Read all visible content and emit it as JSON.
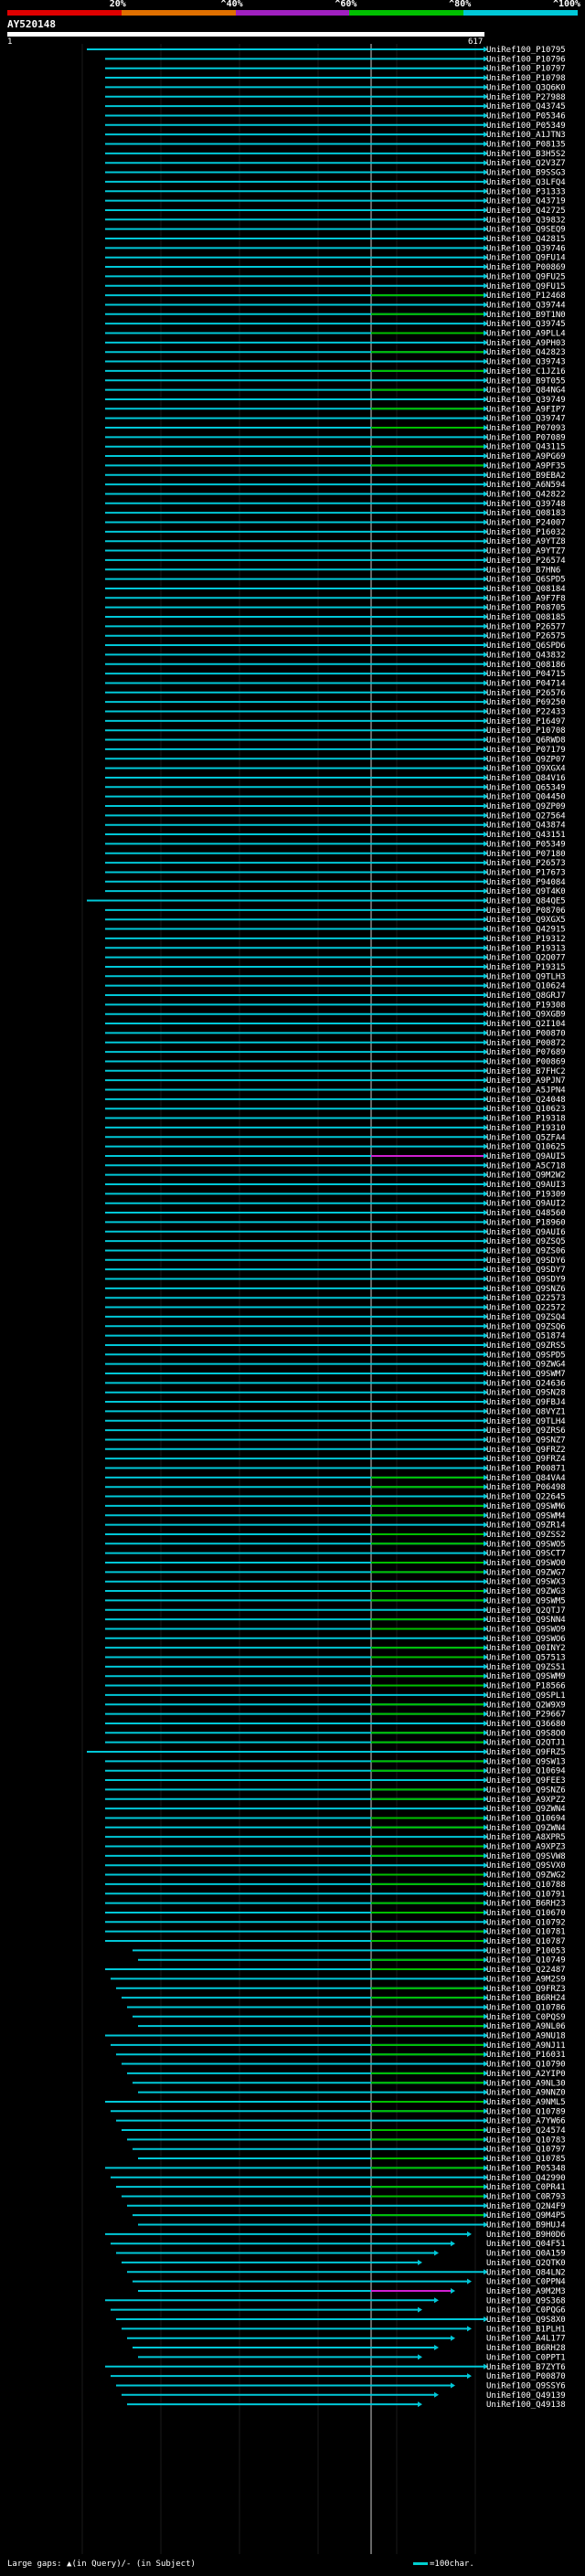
{
  "legend": {
    "labels": [
      "20%",
      "^40%",
      "^60%",
      "^80%",
      "^100%"
    ],
    "colors": [
      "#e00000",
      "#e07000",
      "#a020c0",
      "#00c000",
      "#00c8d8"
    ]
  },
  "query": {
    "title": "AY520148",
    "start": "1",
    "end": "617"
  },
  "hits": {
    "labels": [
      "UniRef100_P10795",
      "UniRef100_P10796",
      "UniRef100_P10797",
      "UniRef100_P10798",
      "UniRef100_Q3Q6K0",
      "UniRef100_P27988",
      "UniRef100_Q43745",
      "UniRef100_P05346",
      "UniRef100_P05349",
      "UniRef100_A1JTN3",
      "UniRef100_P08135",
      "UniRef100_B3H5S2",
      "UniRef100_Q2V3Z7",
      "UniRef100_B9SSG3",
      "UniRef100_Q3LFQ4",
      "UniRef100_P31333",
      "UniRef100_Q43719",
      "UniRef100_Q42725",
      "UniRef100_Q39832",
      "UniRef100_Q9SEQ9",
      "UniRef100_Q42815",
      "UniRef100_Q39746",
      "UniRef100_Q9FU14",
      "UniRef100_P00869",
      "UniRef100_Q9FU25",
      "UniRef100_Q9FU15",
      "UniRef100_P12468",
      "UniRef100_Q39744",
      "UniRef100_B9T1N0",
      "UniRef100_Q39745",
      "UniRef100_A9PLL4",
      "UniRef100_A9PH03",
      "UniRef100_Q42823",
      "UniRef100_Q39743",
      "UniRef100_C1JZ16",
      "UniRef100_B9T055",
      "UniRef100_Q84NG4",
      "UniRef100_Q39749",
      "UniRef100_A9FIP7",
      "UniRef100_Q39747",
      "UniRef100_P07093",
      "UniRef100_P07089",
      "UniRef100_Q43115",
      "UniRef100_A9PG69",
      "UniRef100_A9PF35",
      "UniRef100_B9EBA2",
      "UniRef100_A6N594",
      "UniRef100_Q42822",
      "UniRef100_Q39748",
      "UniRef100_Q08183",
      "UniRef100_P24007",
      "UniRef100_P16032",
      "UniRef100_A9YTZ8",
      "UniRef100_A9YTZ7",
      "UniRef100_P26574",
      "UniRef100_B7HN6",
      "UniRef100_Q6SPD5",
      "UniRef100_Q08184",
      "UniRef100_A9F7F8",
      "UniRef100_P08705",
      "UniRef100_Q08185",
      "UniRef100_P26577",
      "UniRef100_P26575",
      "UniRef100_Q6SPD6",
      "UniRef100_Q43832",
      "UniRef100_Q08186",
      "UniRef100_P04715",
      "UniRef100_P04714",
      "UniRef100_P26576",
      "UniRef100_P69250",
      "UniRef100_P22433",
      "UniRef100_P16497",
      "UniRef100_P10708",
      "UniRef100_Q6RWD8",
      "UniRef100_P07179",
      "UniRef100_Q9ZP07",
      "UniRef100_Q9XGX4",
      "UniRef100_Q84V16",
      "UniRef100_Q65349",
      "UniRef100_Q04450",
      "UniRef100_Q9ZP09",
      "UniRef100_Q27564",
      "UniRef100_Q43874",
      "UniRef100_Q43151",
      "UniRef100_P05349",
      "UniRef100_P07180",
      "UniRef100_P26573",
      "UniRef100_P17673",
      "UniRef100_P94084",
      "UniRef100_Q9T4K0",
      "UniRef100_Q84QE5",
      "UniRef100_P08706",
      "UniRef100_Q9XGX5",
      "UniRef100_Q42915",
      "UniRef100_P19312",
      "UniRef100_P19313",
      "UniRef100_Q2Q077",
      "UniRef100_P19315",
      "UniRef100_Q9TLH3",
      "UniRef100_Q10624",
      "UniRef100_Q8GRJ7",
      "UniRef100_P19308",
      "UniRef100_Q9XGB9",
      "UniRef100_Q2I104",
      "UniRef100_P00870",
      "UniRef100_P00872",
      "UniRef100_P07689",
      "UniRef100_P00869",
      "UniRef100_B7FHC2",
      "UniRef100_A9PJN7",
      "UniRef100_A5JPN4",
      "UniRef100_Q24048",
      "UniRef100_Q10623",
      "UniRef100_P19318",
      "UniRef100_P19310",
      "UniRef100_Q5ZFA4",
      "UniRef100_Q10625",
      "UniRef100_Q9AUI5",
      "UniRef100_A5C718",
      "UniRef100_Q9M2W2",
      "UniRef100_Q9AUI3",
      "UniRef100_P19309",
      "UniRef100_Q9AUI2",
      "UniRef100_Q48560",
      "UniRef100_P18960",
      "UniRef100_Q9AUI6",
      "UniRef100_Q9ZSQ5",
      "UniRef100_Q9ZS06",
      "UniRef100_Q9SDY6",
      "UniRef100_Q9SDY7",
      "UniRef100_Q9SDY9",
      "UniRef100_Q9SNZ6",
      "UniRef100_Q22573",
      "UniRef100_Q22572",
      "UniRef100_Q9ZSQ4",
      "UniRef100_Q9ZSQ6",
      "UniRef100_Q51874",
      "UniRef100_Q9ZRS5",
      "UniRef100_Q9SPD5",
      "UniRef100_Q9ZWG4",
      "UniRef100_Q9SWM7",
      "UniRef100_Q24636",
      "UniRef100_Q9SN28",
      "UniRef100_Q9FBJ4",
      "UniRef100_Q8VYZ1",
      "UniRef100_Q9TLH4",
      "UniRef100_Q9ZRS6",
      "UniRef100_Q9SNZ7",
      "UniRef100_Q9FRZ2",
      "UniRef100_Q9FRZ4",
      "UniRef100_P00871",
      "UniRef100_Q84VA4",
      "UniRef100_P06498",
      "UniRef100_Q22645",
      "UniRef100_Q9SWM6",
      "UniRef100_Q9SWM4",
      "UniRef100_Q9ZR14",
      "UniRef100_Q9ZSS2",
      "UniRef100_Q9SWO5",
      "UniRef100_Q9SCT7",
      "UniRef100_Q9SWO0",
      "UniRef100_Q9ZWG7",
      "UniRef100_Q9SWX3",
      "UniRef100_Q9ZWG3",
      "UniRef100_Q9SWM5",
      "UniRef100_Q2QTJ7",
      "UniRef100_Q9SNN4",
      "UniRef100_Q9SWO9",
      "UniRef100_Q9SWO6",
      "UniRef100_Q0INY2",
      "UniRef100_Q57513",
      "UniRef100_Q9ZS51",
      "UniRef100_Q9SWM9",
      "UniRef100_P18566",
      "UniRef100_Q9SPL1",
      "UniRef100_Q2W9X9",
      "UniRef100_P29667",
      "UniRef100_Q36680",
      "UniRef100_Q9S8O0",
      "UniRef100_Q2QTJ1",
      "UniRef100_Q9FRZ5",
      "UniRef100_Q9SW13",
      "UniRef100_Q10694",
      "UniRef100_Q9FEE3",
      "UniRef100_Q9SNZ6",
      "UniRef100_A9XPZ2",
      "UniRef100_Q9ZWN4",
      "UniRef100_Q10694",
      "UniRef100_Q9ZWN4",
      "UniRef100_A8XPR5",
      "UniRef100_A9XPZ3",
      "UniRef100_Q9SVW8",
      "UniRef100_Q9SVX0",
      "UniRef100_Q9ZWG2",
      "UniRef100_Q10788",
      "UniRef100_Q10791",
      "UniRef100_B6RH23",
      "UniRef100_Q10670",
      "UniRef100_Q10792",
      "UniRef100_Q10781",
      "UniRef100_Q10787",
      "UniRef100_P10053",
      "UniRef100_Q10749",
      "UniRef100_Q22487",
      "UniRef100_A9M2S9",
      "UniRef100_Q9FRZ3",
      "UniRef100_B6RH24",
      "UniRef100_Q10786",
      "UniRef100_C0PQS9",
      "UniRef100_A9NL06",
      "UniRef100_A9NU18",
      "UniRef100_A9NJ11",
      "UniRef100_P16031",
      "UniRef100_Q10790",
      "UniRef100_A2YIP0",
      "UniRef100_A9NL30",
      "UniRef100_A9NNZ0",
      "UniRef100_A9NML5",
      "UniRef100_Q10789",
      "UniRef100_A7YW66",
      "UniRef100_Q24574",
      "UniRef100_Q10783",
      "UniRef100_Q10797",
      "UniRef100_Q10785",
      "UniRef100_P05348",
      "UniRef100_Q42990",
      "UniRef100_C0PR41",
      "UniRef100_C0R793",
      "UniRef100_Q2N4F9",
      "UniRef100_Q9M4P5",
      "UniRef100_B9HUJ4",
      "UniRef100_B9H0D6",
      "UniRef100_Q04F51",
      "UniRef100_Q0A159",
      "UniRef100_Q2QTK0",
      "UniRef100_Q84LN2",
      "UniRef100_C0PPN4",
      "UniRef100_A9M2M3",
      "UniRef100_Q9S368",
      "UniRef100_C0PQG6",
      "UniRef100_Q9S8X0",
      "UniRef100_B1PLH1",
      "UniRef100_A4L177",
      "UniRef100_B6RH28",
      "UniRef100_C0PPT1",
      "UniRef100_B7ZYT6",
      "UniRef100_P00870",
      "UniRef100_Q9SSY6",
      "UniRef100_Q49139",
      "UniRef100_Q49138"
    ]
  },
  "footer": {
    "gaps_text": "Large gaps: ▲(in Query)/- (in Subject)",
    "scale_text": "=100char."
  }
}
